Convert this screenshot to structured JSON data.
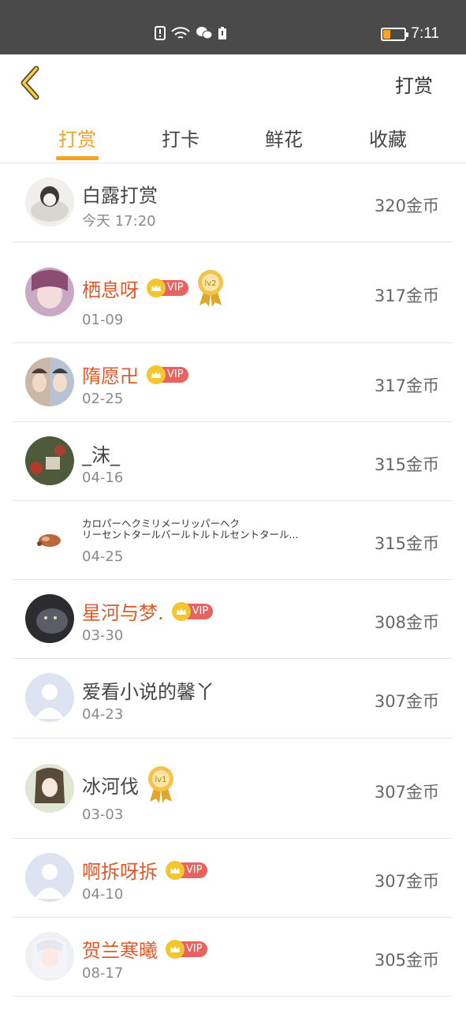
{
  "status_bar": {
    "time": "7:11",
    "battery_level": 0.3,
    "icons": [
      "alert-icon",
      "wifi-icon",
      "wechat-icon",
      "battery-saver-icon"
    ]
  },
  "header": {
    "title": "打赏"
  },
  "tabs": [
    {
      "label": "打赏",
      "active": true
    },
    {
      "label": "打卡",
      "active": false
    },
    {
      "label": "鲜花",
      "active": false
    },
    {
      "label": "收藏",
      "active": false
    }
  ],
  "colors": {
    "accent": "#f5a11b",
    "vip_name": "#e0582a",
    "vip_badge": "#e8625f",
    "crown": "#f3c52f"
  },
  "rows": [
    {
      "name": "白露打赏",
      "date": "今天 17:20",
      "amount": "320金币",
      "vip": false,
      "medal": null
    },
    {
      "name": "栖息呀",
      "date": "01-09",
      "amount": "317金币",
      "vip": true,
      "vip_label": "VIP",
      "medal": "lv2"
    },
    {
      "name": "隋愿卍",
      "date": "02-25",
      "amount": "317金币",
      "vip": true,
      "vip_label": "VIP",
      "medal": null
    },
    {
      "name": "_沫_",
      "date": "04-16",
      "amount": "315金币",
      "vip": false,
      "medal": null
    },
    {
      "name": "カロパーヘクミリメーリッパーヘク\nリーセントタールバールトルトルセントタール...",
      "date": "04-25",
      "amount": "315金币",
      "vip": false,
      "medal": null
    },
    {
      "name": "星河与梦.",
      "date": "03-30",
      "amount": "308金币",
      "vip": true,
      "vip_label": "VIP",
      "medal": null
    },
    {
      "name": "爱看小说的馨丫",
      "date": "04-23",
      "amount": "307金币",
      "vip": false,
      "medal": null
    },
    {
      "name": "冰河伐",
      "date": "03-03",
      "amount": "307金币",
      "vip": false,
      "medal": "lv1"
    },
    {
      "name": "啊拆呀拆",
      "date": "04-10",
      "amount": "307金币",
      "vip": true,
      "vip_label": "VIP",
      "medal": null
    },
    {
      "name": "贺兰寒曦",
      "date": "08-17",
      "amount": "305金币",
      "vip": true,
      "vip_label": "VIP",
      "medal": null
    }
  ]
}
